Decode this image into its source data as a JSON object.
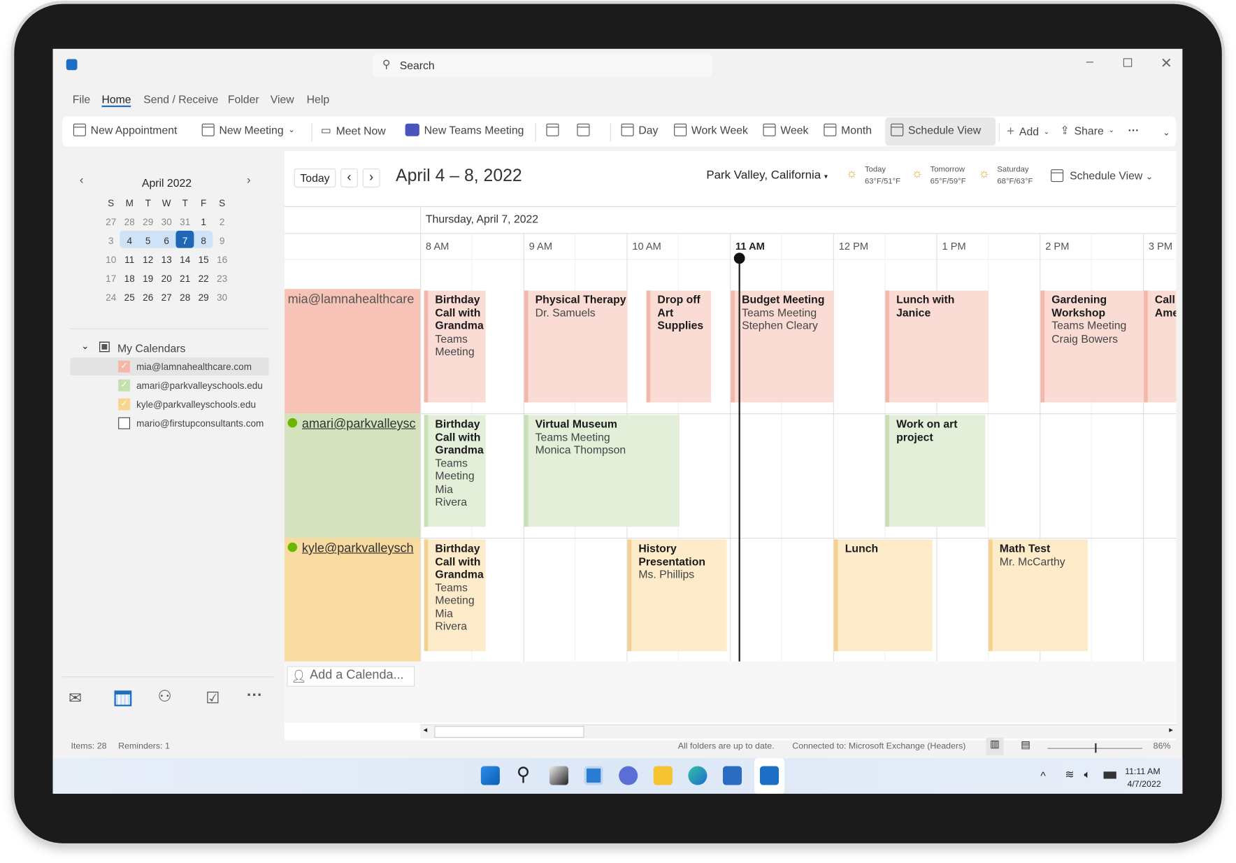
{
  "window": {
    "search_placeholder": "Search",
    "controls": [
      "minimize",
      "maximize",
      "close"
    ]
  },
  "menu": [
    "File",
    "Home",
    "Send / Receive",
    "Folder",
    "View",
    "Help"
  ],
  "ribbon": {
    "new_appointment": "New Appointment",
    "new_meeting": "New Meeting",
    "meet_now": "Meet Now",
    "new_teams_meeting": "New Teams Meeting",
    "day": "Day",
    "work_week": "Work Week",
    "week": "Week",
    "month": "Month",
    "schedule_view": "Schedule View",
    "add": "Add",
    "share": "Share",
    "more": "···"
  },
  "mini_calendar": {
    "title": "April 2022",
    "weekdays": [
      "S",
      "M",
      "T",
      "W",
      "T",
      "F",
      "S"
    ],
    "weeks": [
      [
        "27",
        "28",
        "29",
        "30",
        "31",
        "1",
        "2"
      ],
      [
        "3",
        "4",
        "5",
        "6",
        "7",
        "8",
        "9"
      ],
      [
        "10",
        "11",
        "12",
        "13",
        "14",
        "15",
        "16"
      ],
      [
        "17",
        "18",
        "19",
        "20",
        "21",
        "22",
        "23"
      ],
      [
        "24",
        "25",
        "26",
        "27",
        "28",
        "29",
        "30"
      ]
    ],
    "selected_day": "7",
    "selected_week": [
      "4",
      "5",
      "6",
      "7",
      "8"
    ]
  },
  "calendars": {
    "group": "My Calendars",
    "items": [
      {
        "label": "mia@lamnahealthcare.com",
        "checked": true,
        "color": "#f4b7aa"
      },
      {
        "label": "amari@parkvalleyschools.edu",
        "checked": true,
        "color": "#c5dfae"
      },
      {
        "label": "kyle@parkvalleyschools.edu",
        "checked": true,
        "color": "#f6d68f"
      },
      {
        "label": "mario@firstupconsultants.com",
        "checked": false
      }
    ]
  },
  "header": {
    "today": "Today",
    "range": "April 4 – 8, 2022",
    "location": "Park Valley, California",
    "weather": [
      {
        "day": "Today",
        "temp": "63°F/51°F"
      },
      {
        "day": "Tomorrow",
        "temp": "65°F/59°F"
      },
      {
        "day": "Saturday",
        "temp": "68°F/63°F"
      }
    ],
    "view": "Schedule View"
  },
  "schedule": {
    "date": "Thursday, April 7, 2022",
    "hours": [
      "8 AM",
      "9 AM",
      "10 AM",
      "11 AM",
      "12 PM",
      "1 PM",
      "2 PM",
      "3 PM"
    ],
    "current_hour": "11 AM",
    "rows": [
      {
        "label": "mia@lamnahealthcare",
        "color": "#f7c3b7",
        "events": [
          {
            "title": "Birthday Call with Grandma",
            "lines": [
              "Teams Meeting"
            ]
          },
          {
            "title": "Physical Therapy",
            "lines": [
              "Dr. Samuels"
            ]
          },
          {
            "title": "Drop off Art Supplies",
            "lines": []
          },
          {
            "title": "Budget Meeting",
            "lines": [
              "Teams Meeting",
              "Stephen Cleary"
            ]
          },
          {
            "title": "Lunch with Janice",
            "lines": []
          },
          {
            "title": "Gardening Workshop",
            "lines": [
              "Teams Meeting",
              "Craig Bowers"
            ]
          },
          {
            "title": "Call Ame",
            "lines": []
          }
        ]
      },
      {
        "label": "amari@parkvalleysc",
        "color": "#d4e3bd",
        "events": [
          {
            "title": "Birthday Call with Grandma",
            "lines": [
              "Teams Meeting",
              "Mia Rivera"
            ]
          },
          {
            "title": "Virtual Museum",
            "lines": [
              "Teams Meeting",
              "Monica Thompson"
            ]
          },
          {
            "title": "Work on art project",
            "lines": []
          }
        ]
      },
      {
        "label": "kyle@parkvalleysch",
        "color": "#f8dba0",
        "events": [
          {
            "title": "Birthday Call with Grandma",
            "lines": [
              "Teams Meeting",
              "Mia Rivera"
            ]
          },
          {
            "title": "History Presentation",
            "lines": [
              "Ms. Phillips"
            ]
          },
          {
            "title": "Lunch",
            "lines": []
          },
          {
            "title": "Math Test",
            "lines": [
              "Mr. McCarthy"
            ]
          }
        ]
      }
    ],
    "add_calendar": "Add a Calenda..."
  },
  "status": {
    "items": "Items: 28",
    "reminders": "Reminders: 1",
    "sync": "All folders are up to date.",
    "connection": "Connected to: Microsoft Exchange (Headers)",
    "zoom": "86%",
    "zoom_value": 86
  },
  "taskbar": {
    "time": "11:11 AM",
    "date": "4/7/2022"
  }
}
